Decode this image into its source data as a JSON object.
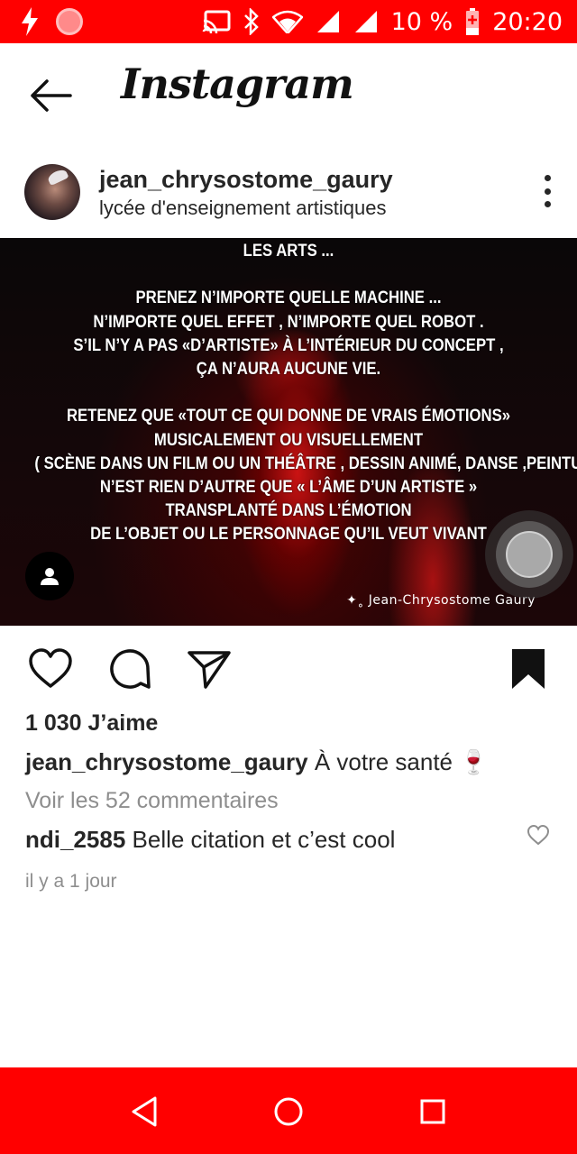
{
  "status_bar": {
    "battery": "10 %",
    "time": "20:20",
    "icons": [
      "flash-icon",
      "record-icon",
      "cast-icon",
      "bluetooth-icon",
      "wifi-icon",
      "signal-icon",
      "battery-charging-icon"
    ]
  },
  "header": {
    "app_title": "Instagram",
    "back_icon": "arrow-left-icon"
  },
  "post": {
    "username": "jean_chrysostome_gaury",
    "location": "lycée d'enseignement artistiques",
    "image": {
      "quote_lines": [
        "LES ARTS ...",
        "",
        "PRENEZ N’IMPORTE QUELLE MACHINE ...",
        "N’IMPORTE QUEL EFFET , N’IMPORTE QUEL ROBOT .",
        "S’IL N’Y A PAS «D’ARTISTE» À L’INTÉRIEUR DU CONCEPT ,",
        "ÇA N’AURA AUCUNE VIE.",
        "",
        "RETENEZ QUE «TOUT CE QUI DONNE DE VRAIS ÉMOTIONS»",
        "MUSICALEMENT OU  VISUELLEMENT",
        "( SCÈNE DANS UN FILM OU UN THÉÂTRE , DESSIN ANIMÉ, DANSE ,PEINTURE ETC )",
        "N’EST RIEN D’AUTRE QUE « L’ÂME D’UN ARTISTE »",
        "TRANSPLANTÉ DANS L’ÉMOTION",
        "DE L’OBJET OU LE PERSONNAGE QU’IL VEUT VIVANT"
      ],
      "signature": "✦˳ Jean-Chrysostome Gaury"
    },
    "likes": "1 030 J’aime",
    "caption_user": "jean_chrysostome_gaury",
    "caption_text": " À votre santé 🍷",
    "view_comments": "Voir les 52 commentaires",
    "comment_user": "ndi_2585",
    "comment_text": " Belle citation et c’est cool",
    "timestamp": "il y a 1 jour"
  },
  "colors": {
    "system_bar": "#ff0000",
    "text": "#262626",
    "muted": "#8e8e8e"
  }
}
